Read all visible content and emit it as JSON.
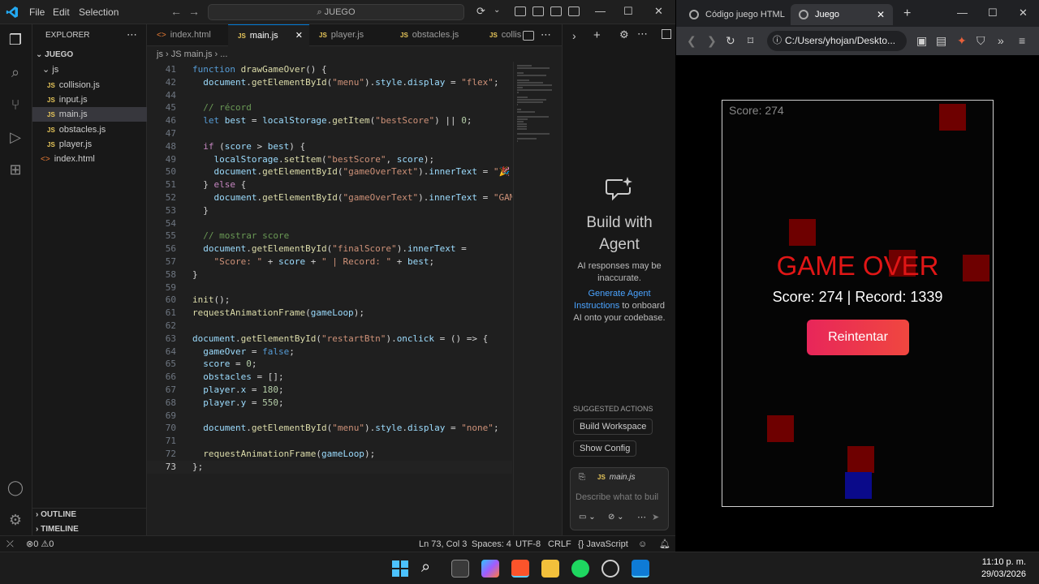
{
  "vscode": {
    "menu": [
      "File",
      "Edit",
      "Selection"
    ],
    "search": "JUEGO",
    "explorer": {
      "title": "EXPLORER",
      "root": "JUEGO",
      "folder": "js",
      "files": [
        "collision.js",
        "input.js",
        "main.js",
        "obstacles.js",
        "player.js"
      ],
      "html_file": "index.html",
      "outline": "OUTLINE",
      "timeline": "TIMELINE"
    },
    "tabs": [
      "index.html",
      "main.js",
      "player.js",
      "obstacles.js",
      "collis"
    ],
    "breadcrumb": "js  ›  JS main.js  ›  ...",
    "code": [
      {
        "n": "41",
        "t": "function drawGameOver() {"
      },
      {
        "n": "42",
        "t": "  document.getElementById(\"menu\").style.display = \"flex\";"
      },
      {
        "n": "44",
        "t": ""
      },
      {
        "n": "45",
        "t": "  // récord"
      },
      {
        "n": "46",
        "t": "  let best = localStorage.getItem(\"bestScore\") || 0;"
      },
      {
        "n": "47",
        "t": ""
      },
      {
        "n": "48",
        "t": "  if (score > best) {"
      },
      {
        "n": "49",
        "t": "    localStorage.setItem(\"bestScore\", score);"
      },
      {
        "n": "50",
        "t": "    document.getElementById(\"gameOverText\").innerText = \"🎉 N"
      },
      {
        "n": "51",
        "t": "  } else {"
      },
      {
        "n": "52",
        "t": "    document.getElementById(\"gameOverText\").innerText = \"GAME"
      },
      {
        "n": "53",
        "t": "  }"
      },
      {
        "n": "54",
        "t": ""
      },
      {
        "n": "55",
        "t": "  // mostrar score"
      },
      {
        "n": "56",
        "t": "  document.getElementById(\"finalScore\").innerText ="
      },
      {
        "n": "57",
        "t": "    \"Score: \" + score + \" | Record: \" + best;"
      },
      {
        "n": "58",
        "t": "}"
      },
      {
        "n": "59",
        "t": ""
      },
      {
        "n": "60",
        "t": "init();"
      },
      {
        "n": "61",
        "t": "requestAnimationFrame(gameLoop);"
      },
      {
        "n": "62",
        "t": ""
      },
      {
        "n": "63",
        "t": "document.getElementById(\"restartBtn\").onclick = () => {"
      },
      {
        "n": "64",
        "t": "  gameOver = false;"
      },
      {
        "n": "65",
        "t": "  score = 0;"
      },
      {
        "n": "66",
        "t": "  obstacles = [];"
      },
      {
        "n": "67",
        "t": "  player.x = 180;"
      },
      {
        "n": "68",
        "t": "  player.y = 550;"
      },
      {
        "n": "69",
        "t": ""
      },
      {
        "n": "70",
        "t": "  document.getElementById(\"menu\").style.display = \"none\";"
      },
      {
        "n": "71",
        "t": ""
      },
      {
        "n": "72",
        "t": "  requestAnimationFrame(gameLoop);"
      },
      {
        "n": "73",
        "t": "};"
      }
    ],
    "agent": {
      "title_line1": "Build with",
      "title_line2": "Agent",
      "disclaimer": "AI responses may be inaccurate.",
      "link": "Generate Agent Instructions",
      "link_suffix": "to onboard AI onto your codebase.",
      "suggested_title": "SUGGESTED ACTIONS",
      "suggested": [
        "Build Workspace",
        "Show Config"
      ],
      "context_file": "main.js",
      "input_placeholder": "Describe what to buil"
    },
    "status": {
      "errors": "0",
      "warnings": "0",
      "position": "Ln 73, Col 3",
      "spaces": "Spaces: 4",
      "encoding": "UTF-8",
      "eol": "CRLF",
      "language": "JavaScript"
    }
  },
  "browser": {
    "tabs": [
      "Código juego HTML",
      "Juego"
    ],
    "url": "C:/Users/yhojan/Deskto...",
    "game": {
      "hud_score": "Score: 274",
      "title": "GAME OVER",
      "final": "Score: 274 | Record: 1339",
      "button": "Reintentar"
    }
  },
  "taskbar": {
    "time": "11:10 p. m.",
    "date": "29/03/2026"
  }
}
